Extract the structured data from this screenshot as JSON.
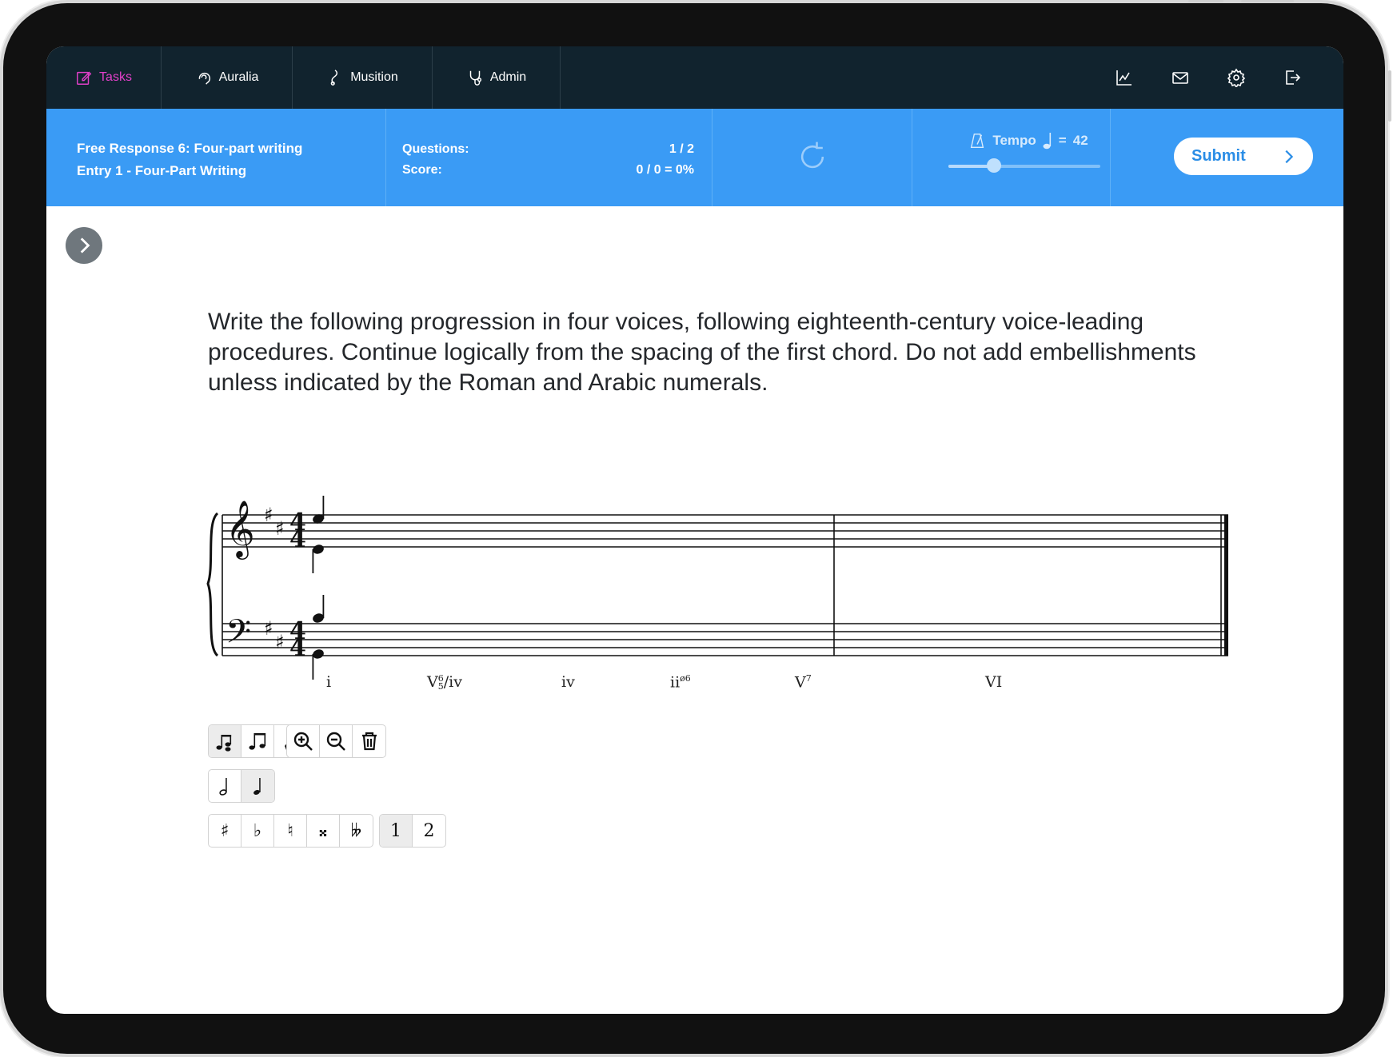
{
  "nav": {
    "tabs": [
      {
        "label": "Tasks",
        "icon": "edit-icon",
        "active": true
      },
      {
        "label": "Auralia",
        "icon": "auralia-icon"
      },
      {
        "label": "Musition",
        "icon": "musition-icon"
      },
      {
        "label": "Admin",
        "icon": "admin-icon"
      }
    ],
    "right_icons": [
      "chart-icon",
      "mail-icon",
      "gear-icon",
      "logout-icon"
    ]
  },
  "header": {
    "title_line1": "Free Response 6: Four-part writing",
    "title_line2": "Entry 1 - Four-Part Writing",
    "questions_label": "Questions:",
    "questions_value": "1 / 2",
    "score_label": "Score:",
    "score_value": "0 / 0 = 0%",
    "tempo_label": "Tempo",
    "tempo_equals": "=",
    "tempo_value": "42",
    "tempo_level_fraction": 0.3,
    "submit_label": "Submit"
  },
  "instruction": "Write the following progression in four voices, following eighteenth-century voice-leading procedures. Continue logically from the spacing of the first chord. Do not add embellishments unless indicated by the Roman and Arabic numerals.",
  "score": {
    "key_signature": "2 sharps",
    "time_signature": "4/4",
    "measures": 2
  },
  "chords": [
    {
      "base": "i",
      "sup": "",
      "sub": ""
    },
    {
      "base": "V",
      "sup": "6",
      "sub": "5",
      "suffix": "/iv"
    },
    {
      "base": "iv",
      "sup": "",
      "sub": ""
    },
    {
      "base": "ii",
      "sup": "ø6",
      "sub": ""
    },
    {
      "base": "V",
      "sup": "7",
      "sub": ""
    },
    {
      "base": "VI",
      "sup": "",
      "sub": ""
    }
  ],
  "toolbar": {
    "mode_tools": [
      "voices-icon",
      "note-icon",
      "eraser-icon"
    ],
    "view_tools": [
      "zoom-in-icon",
      "zoom-out-icon",
      "trash-icon"
    ],
    "durations": [
      "half-note-icon",
      "quarter-note-icon"
    ],
    "accidentals": [
      "♯",
      "♭",
      "♮",
      "𝄪",
      "𝄫"
    ],
    "voices": [
      "1",
      "2"
    ]
  },
  "colors": {
    "nav_bg": "#11232e",
    "header_bg": "#3a9bf5",
    "active_tab": "#e040c8",
    "submit_text": "#2a8de6"
  }
}
